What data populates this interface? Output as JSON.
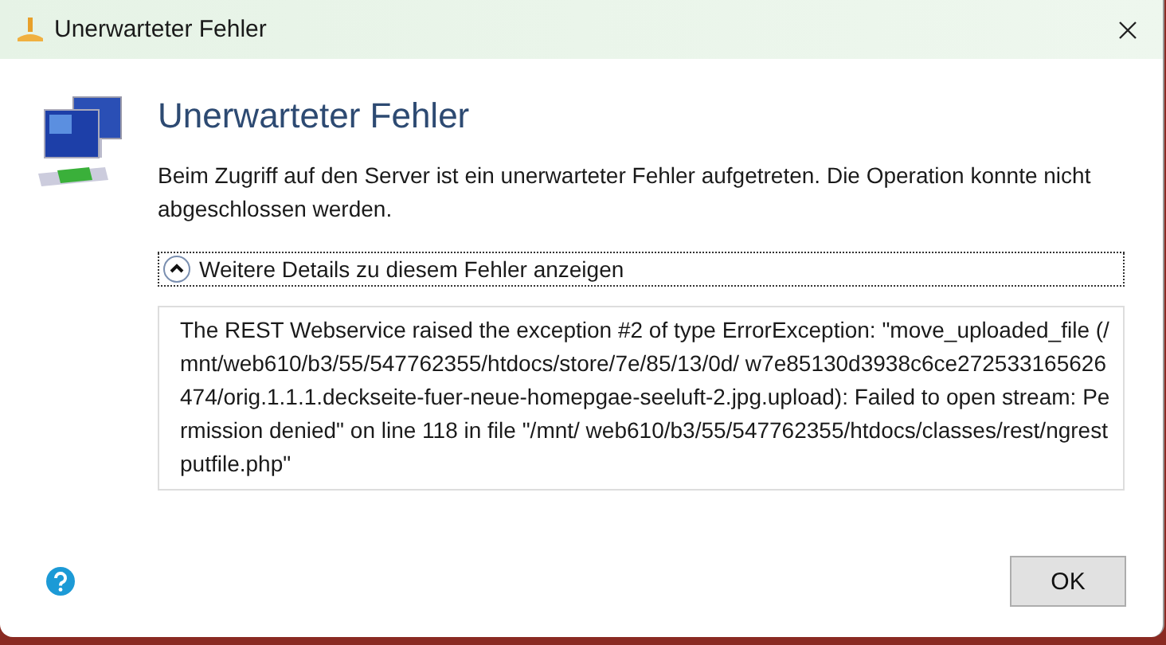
{
  "window": {
    "title": "Unerwarteter Fehler"
  },
  "heading": "Unerwarteter Fehler",
  "message": "Beim Zugriff auf den Server ist ein unerwarteter Fehler aufgetreten. Die Operation konnte nicht abgeschlossen werden.",
  "details": {
    "label": "Weitere Details zu diesem Fehler anzeigen",
    "expanded": true,
    "text": "The REST Webservice raised the exception #2 of type ErrorException: \"move_uploaded_file (/mnt/web610/b3/55/547762355/htdocs/store/7e/85/13/0d/ w7e85130d3938c6ce272533165626474/orig.1.1.1.deckseite-fuer-neue-homepgae-seeluft-2.jpg.upload): Failed to open stream: Permission denied\" on line 118 in file \"/mnt/ web610/b3/55/547762355/htdocs/classes/rest/ngrestputfile.php\""
  },
  "buttons": [
    "OK"
  ]
}
